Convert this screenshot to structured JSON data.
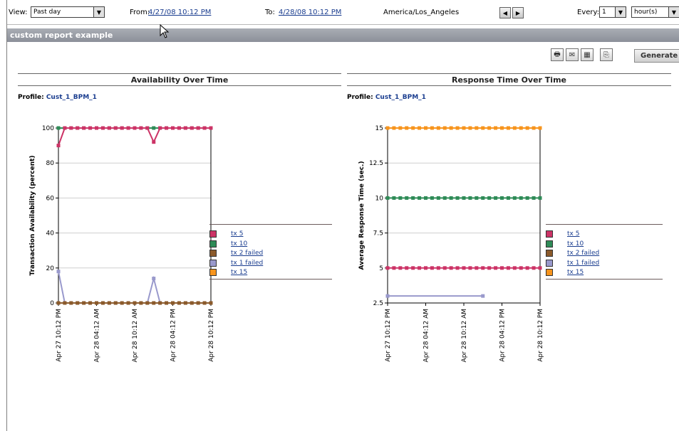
{
  "toolbar": {
    "view_label": "View:",
    "view_value": "Past day",
    "from_label": "From:",
    "from_value": "4/27/08 10:12 PM",
    "to_label": "To:",
    "to_value": "4/28/08 10:12 PM",
    "timezone": "America/Los_Angeles",
    "every_label": "Every:",
    "every_value": "1",
    "unit_value": "hour(s)"
  },
  "report": {
    "title": "custom report example",
    "generate_label": "Generate",
    "action_icons": [
      "print-icon",
      "email-icon",
      "export-csv-icon",
      "export-pdf-icon"
    ]
  },
  "charts": [
    {
      "header": "Availability Over Time",
      "profile_label": "Profile:",
      "profile_value": "Cust_1_BPM_1",
      "ylabel": "Transaction Availability (percent)",
      "yticks": [
        "0",
        "20",
        "40",
        "60",
        "80",
        "100"
      ],
      "xticks": [
        "Apr 27 10:12 PM",
        "Apr 28 04:12 AM",
        "Apr 28 10:12 AM",
        "Apr 28 04:12 PM",
        "Apr 28 10:12 PM"
      ]
    },
    {
      "header": "Response Time Over Time",
      "profile_label": "Profile:",
      "profile_value": "Cust_1_BPM_1",
      "ylabel": "Average Response Time (sec.)",
      "yticks": [
        "2.5",
        "5",
        "7.5",
        "10",
        "12.5",
        "15"
      ],
      "xticks": [
        "Apr 27 10:12 PM",
        "Apr 28 04:12 AM",
        "Apr 28 10:12 AM",
        "Apr 28 04:12 PM",
        "Apr 28 10:12 PM"
      ]
    }
  ],
  "chart_data": [
    {
      "type": "line",
      "ylabel": "Transaction Availability (percent)",
      "ylim": [
        0,
        100
      ],
      "x": [
        "Apr 27 10:12 PM",
        "Apr 27 11:12 PM",
        "Apr 28 12:12 AM",
        "Apr 28 01:12 AM",
        "Apr 28 02:12 AM",
        "Apr 28 03:12 AM",
        "Apr 28 04:12 AM",
        "Apr 28 05:12 AM",
        "Apr 28 06:12 AM",
        "Apr 28 07:12 AM",
        "Apr 28 08:12 AM",
        "Apr 28 09:12 AM",
        "Apr 28 10:12 AM",
        "Apr 28 11:12 AM",
        "Apr 28 12:12 PM",
        "Apr 28 01:12 PM",
        "Apr 28 02:12 PM",
        "Apr 28 03:12 PM",
        "Apr 28 04:12 PM",
        "Apr 28 05:12 PM",
        "Apr 28 06:12 PM",
        "Apr 28 07:12 PM",
        "Apr 28 08:12 PM",
        "Apr 28 09:12 PM",
        "Apr 28 10:12 PM"
      ],
      "grid": true,
      "series": [
        {
          "name": "tx 10",
          "color": "#2e8b57",
          "values": [
            100,
            100,
            100,
            100,
            100,
            100,
            100,
            100,
            100,
            100,
            100,
            100,
            100,
            100,
            100,
            100,
            100,
            100,
            100,
            100,
            100,
            100,
            100,
            100,
            100
          ]
        },
        {
          "name": "tx 5",
          "color": "#cc3366",
          "values": [
            90,
            100,
            100,
            100,
            100,
            100,
            100,
            100,
            100,
            100,
            100,
            100,
            100,
            100,
            100,
            92,
            100,
            100,
            100,
            100,
            100,
            100,
            100,
            100,
            100
          ]
        },
        {
          "name": "tx 1 failed",
          "color": "#9999cc",
          "values": [
            18,
            0,
            0,
            0,
            0,
            0,
            0,
            0,
            0,
            0,
            0,
            0,
            0,
            0,
            0,
            14,
            0,
            0,
            0,
            0,
            0,
            0,
            0,
            0,
            0
          ]
        },
        {
          "name": "tx 2 failed",
          "color": "#8b5a2b",
          "values": [
            0,
            0,
            0,
            0,
            0,
            0,
            0,
            0,
            0,
            0,
            0,
            0,
            0,
            0,
            0,
            0,
            0,
            0,
            0,
            0,
            0,
            0,
            0,
            0,
            0
          ]
        }
      ],
      "legend": [
        "tx 5",
        "tx 10",
        "tx 2 failed",
        "tx 1 failed",
        "tx 15"
      ]
    },
    {
      "type": "line",
      "ylabel": "Average Response Time (sec.)",
      "ylim": [
        2.5,
        15
      ],
      "x": [
        "Apr 27 10:12 PM",
        "Apr 27 11:12 PM",
        "Apr 28 12:12 AM",
        "Apr 28 01:12 AM",
        "Apr 28 02:12 AM",
        "Apr 28 03:12 AM",
        "Apr 28 04:12 AM",
        "Apr 28 05:12 AM",
        "Apr 28 06:12 AM",
        "Apr 28 07:12 AM",
        "Apr 28 08:12 AM",
        "Apr 28 09:12 AM",
        "Apr 28 10:12 AM",
        "Apr 28 11:12 AM",
        "Apr 28 12:12 PM",
        "Apr 28 01:12 PM",
        "Apr 28 02:12 PM",
        "Apr 28 03:12 PM",
        "Apr 28 04:12 PM",
        "Apr 28 05:12 PM",
        "Apr 28 06:12 PM",
        "Apr 28 07:12 PM",
        "Apr 28 08:12 PM",
        "Apr 28 09:12 PM",
        "Apr 28 10:12 PM"
      ],
      "grid": true,
      "series": [
        {
          "name": "tx 15",
          "color": "#f7941d",
          "values": [
            15,
            15,
            15,
            15,
            15,
            15,
            15,
            15,
            15,
            15,
            15,
            15,
            15,
            15,
            15,
            15,
            15,
            15,
            15,
            15,
            15,
            15,
            15,
            15,
            15
          ]
        },
        {
          "name": "tx 10",
          "color": "#2e8b57",
          "values": [
            10,
            10,
            10,
            10,
            10,
            10,
            10,
            10,
            10,
            10,
            10,
            10,
            10,
            10,
            10,
            10,
            10,
            10,
            10,
            10,
            10,
            10,
            10,
            10,
            10
          ]
        },
        {
          "name": "tx 5",
          "color": "#cc3366",
          "values": [
            5,
            5,
            5,
            5,
            5,
            5,
            5,
            5,
            5,
            5,
            5,
            5,
            5,
            5,
            5,
            5,
            5,
            5,
            5,
            5,
            5,
            5,
            5,
            5,
            5
          ]
        },
        {
          "name": "tx 1 failed",
          "color": "#9999cc",
          "values": [
            3,
            null,
            null,
            null,
            null,
            null,
            null,
            null,
            null,
            null,
            null,
            null,
            null,
            null,
            null,
            3,
            null,
            null,
            null,
            null,
            null,
            null,
            null,
            null,
            null
          ],
          "line_segment_only": true
        }
      ],
      "legend": [
        "tx 5",
        "tx 10",
        "tx 2 failed",
        "tx 1 failed",
        "tx 15"
      ]
    }
  ],
  "legend": [
    {
      "label": "tx 5",
      "color": "#cc3366"
    },
    {
      "label": "tx 10",
      "color": "#2e8b57"
    },
    {
      "label": "tx 2 failed",
      "color": "#8b5a2b"
    },
    {
      "label": "tx 1 failed",
      "color": "#9999cc"
    },
    {
      "label": "tx 15",
      "color": "#f7941d"
    }
  ]
}
